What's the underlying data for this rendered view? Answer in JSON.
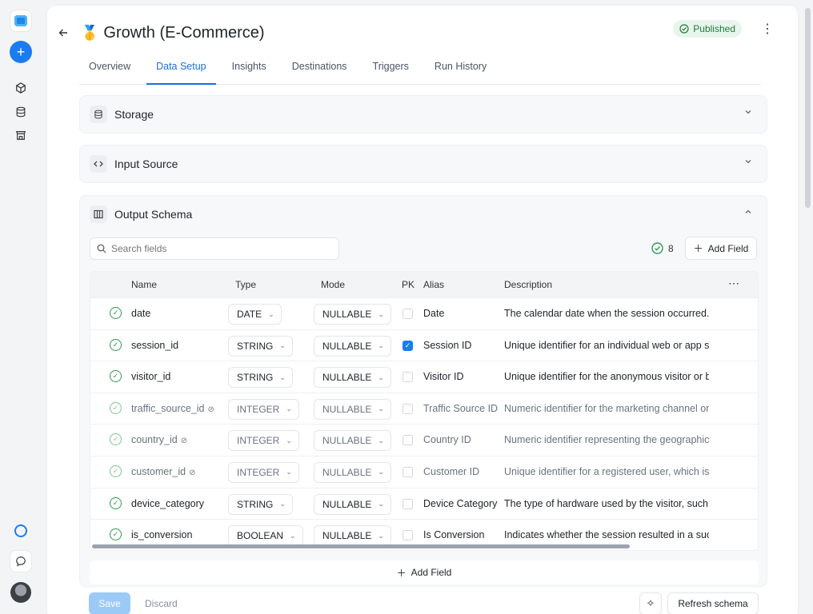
{
  "header": {
    "title": "Growth (E-Commerce)",
    "medal": "🥇",
    "status": "Published",
    "back_icon": "arrow-left-icon",
    "more_icon": "more-vertical-icon"
  },
  "tabs": [
    "Overview",
    "Data Setup",
    "Insights",
    "Destinations",
    "Triggers",
    "Run History"
  ],
  "active_tab": "Data Setup",
  "sections": {
    "storage": "Storage",
    "input_source": "Input Source",
    "output_schema": "Output Schema"
  },
  "schema": {
    "search_placeholder": "Search fields",
    "count": "8",
    "add_field": "Add Field",
    "columns": {
      "name": "Name",
      "type": "Type",
      "mode": "Mode",
      "pk": "PK",
      "alias": "Alias",
      "description": "Description"
    },
    "rows": [
      {
        "name": "date",
        "type": "DATE",
        "mode": "NULLABLE",
        "pk": false,
        "alias": "Date",
        "description": "The calendar date when the session occurred.",
        "hidden": false
      },
      {
        "name": "session_id",
        "type": "STRING",
        "mode": "NULLABLE",
        "pk": true,
        "alias": "Session ID",
        "description": "Unique identifier for an individual web or app ses",
        "hidden": false
      },
      {
        "name": "visitor_id",
        "type": "STRING",
        "mode": "NULLABLE",
        "pk": false,
        "alias": "Visitor ID",
        "description": "Unique identifier for the anonymous visitor or bro",
        "hidden": false
      },
      {
        "name": "traffic_source_id",
        "type": "INTEGER",
        "mode": "NULLABLE",
        "pk": false,
        "alias": "Traffic Source ID",
        "description": "Numeric identifier for the marketing channel or re",
        "hidden": true
      },
      {
        "name": "country_id",
        "type": "INTEGER",
        "mode": "NULLABLE",
        "pk": false,
        "alias": "Country ID",
        "description": "Numeric identifier representing the geographic c",
        "hidden": true
      },
      {
        "name": "customer_id",
        "type": "INTEGER",
        "mode": "NULLABLE",
        "pk": false,
        "alias": "Customer ID",
        "description": "Unique identifier for a registered user, which is no",
        "hidden": true
      },
      {
        "name": "device_category",
        "type": "STRING",
        "mode": "NULLABLE",
        "pk": false,
        "alias": "Device Category",
        "description": "The type of hardware used by the visitor, such as",
        "hidden": false
      },
      {
        "name": "is_conversion",
        "type": "BOOLEAN",
        "mode": "NULLABLE",
        "pk": false,
        "alias": "Is Conversion",
        "description": "Indicates whether the session resulted in a succe",
        "hidden": false
      }
    ]
  },
  "footer": {
    "save": "Save",
    "discard": "Discard",
    "refresh": "Refresh schema"
  },
  "colors": {
    "accent": "#1a7cf0",
    "published_bg": "#e8f5ec",
    "published_text": "#1f7a3d",
    "ok_green": "#2e9b55"
  }
}
